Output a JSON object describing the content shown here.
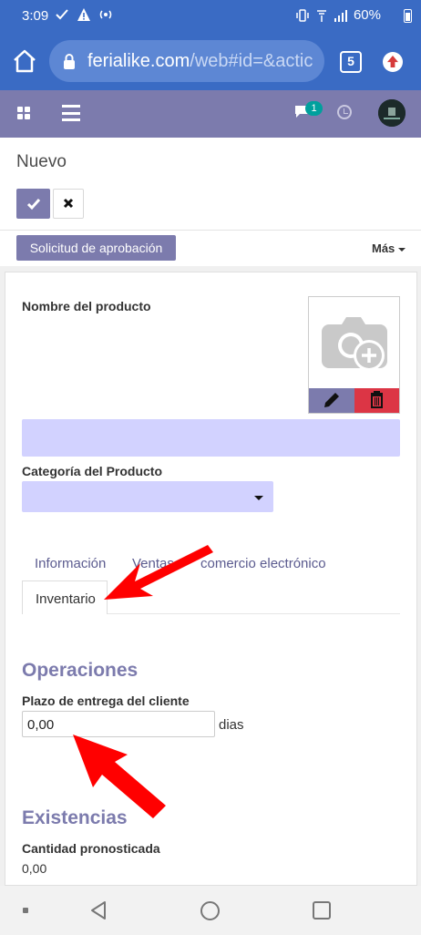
{
  "status_bar": {
    "time": "3:09",
    "battery": "60%"
  },
  "browser": {
    "url_host": "ferialike.com",
    "url_path": "/web#id=&actic",
    "tab_count": "5"
  },
  "navbar": {
    "chat_badge": "1"
  },
  "control_panel": {
    "breadcrumb": "Nuevo",
    "approval_button": "Solicitud de aprobación",
    "more_button": "Más"
  },
  "form": {
    "product_name_label": "Nombre del producto",
    "product_name_value": "",
    "category_label": "Categoría del Producto",
    "category_value": "",
    "tabs": [
      {
        "label": "Información"
      },
      {
        "label": "Ventas"
      },
      {
        "label": "comercio electrónico"
      },
      {
        "label": "Inventario"
      }
    ],
    "operations_title": "Operaciones",
    "lead_time_label": "Plazo de entrega del cliente",
    "lead_time_value": "0,00",
    "lead_time_unit": "dias",
    "stock_title": "Existencias",
    "forecast_label": "Cantidad pronosticada",
    "forecast_value": "0,00"
  },
  "colors": {
    "browser": "#3a6bc4",
    "odoo_purple": "#7c7bad",
    "input_required": "#d2d2ff",
    "danger": "#dc3545",
    "annotation_arrow": "#ff0000"
  }
}
